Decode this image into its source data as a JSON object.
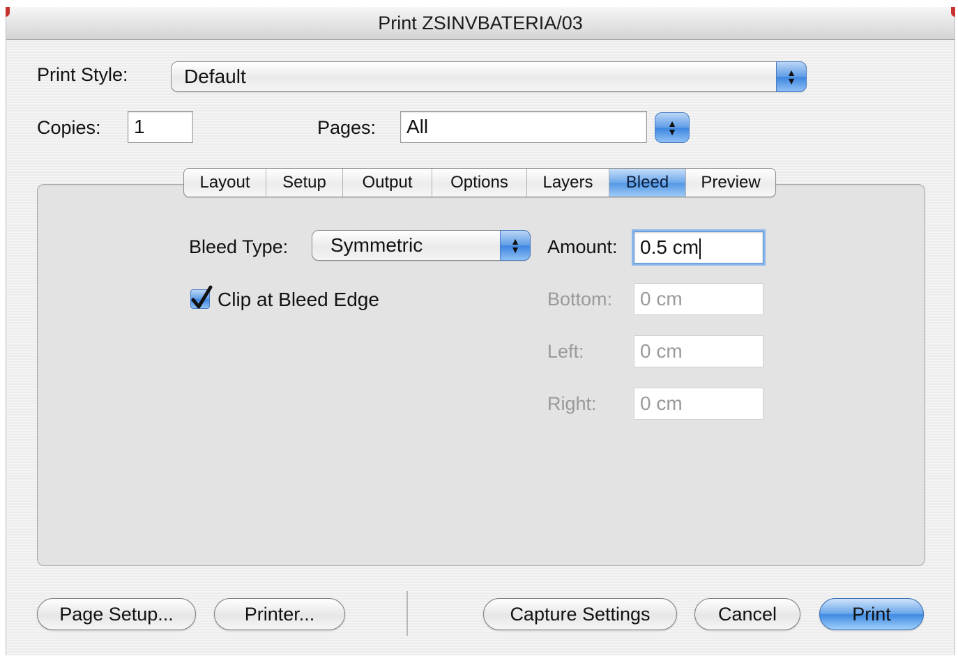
{
  "window": {
    "title": "Print ZSINVBATERIA/03"
  },
  "print_style": {
    "label": "Print Style:",
    "value": "Default"
  },
  "copies": {
    "label": "Copies:",
    "value": "1"
  },
  "pages": {
    "label": "Pages:",
    "value": "All"
  },
  "tabs": [
    {
      "label": "Layout",
      "active": false
    },
    {
      "label": "Setup",
      "active": false
    },
    {
      "label": "Output",
      "active": false
    },
    {
      "label": "Options",
      "active": false
    },
    {
      "label": "Layers",
      "active": false
    },
    {
      "label": "Bleed",
      "active": true
    },
    {
      "label": "Preview",
      "active": false
    }
  ],
  "bleed": {
    "type_label": "Bleed Type:",
    "type_value": "Symmetric",
    "clip_label": "Clip at Bleed Edge",
    "clip_checked": true,
    "amount_label": "Amount:",
    "amount_value": "0.5 cm",
    "bottom_label": "Bottom:",
    "bottom_value": "0 cm",
    "left_label": "Left:",
    "left_value": "0 cm",
    "right_label": "Right:",
    "right_value": "0 cm"
  },
  "buttons": {
    "page_setup": "Page Setup...",
    "printer": "Printer...",
    "capture_settings": "Capture Settings",
    "cancel": "Cancel",
    "print": "Print"
  },
  "colors": {
    "accent": "#5398e6",
    "disabled_text": "#9a9a9a"
  }
}
